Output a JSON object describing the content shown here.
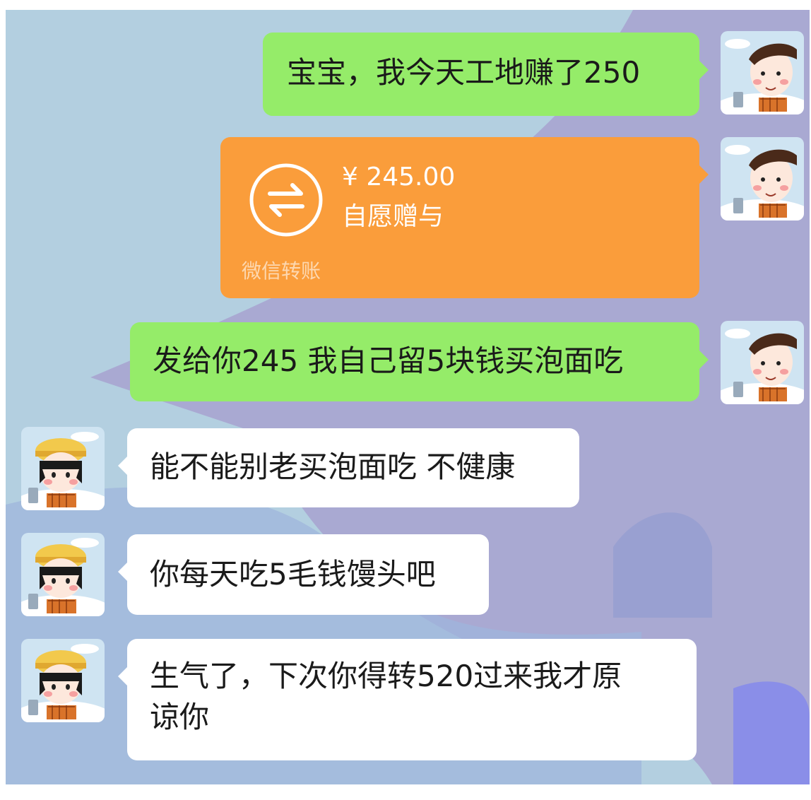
{
  "messages": [
    {
      "side": "sent",
      "type": "text",
      "text": "宝宝，我今天工地赚了250"
    },
    {
      "side": "sent",
      "type": "transfer",
      "amount": "¥ 245.00",
      "note": "自愿赠与",
      "footer": "微信转账"
    },
    {
      "side": "sent",
      "type": "text",
      "text": "发给你245 我自己留5块钱买泡面吃"
    },
    {
      "side": "received",
      "type": "text",
      "text": "能不能别老买泡面吃 不健康"
    },
    {
      "side": "received",
      "type": "text",
      "text": "你每天吃5毛钱馒头吧"
    },
    {
      "side": "received",
      "type": "text",
      "lines": [
        "生气了，下次你得转520过来我才原",
        "谅你"
      ]
    }
  ],
  "colors": {
    "sent_bubble": "#95ec69",
    "received_bubble": "#ffffff",
    "transfer_bubble": "#fa9d3b",
    "chat_background_light": "#b3cfe0",
    "chat_background_purple": "#a9a9d2"
  },
  "icons": {
    "transfer": "transfer-arrows-icon",
    "sender_avatar": "boy-cartoon-avatar",
    "receiver_avatar": "girl-cartoon-avatar"
  }
}
